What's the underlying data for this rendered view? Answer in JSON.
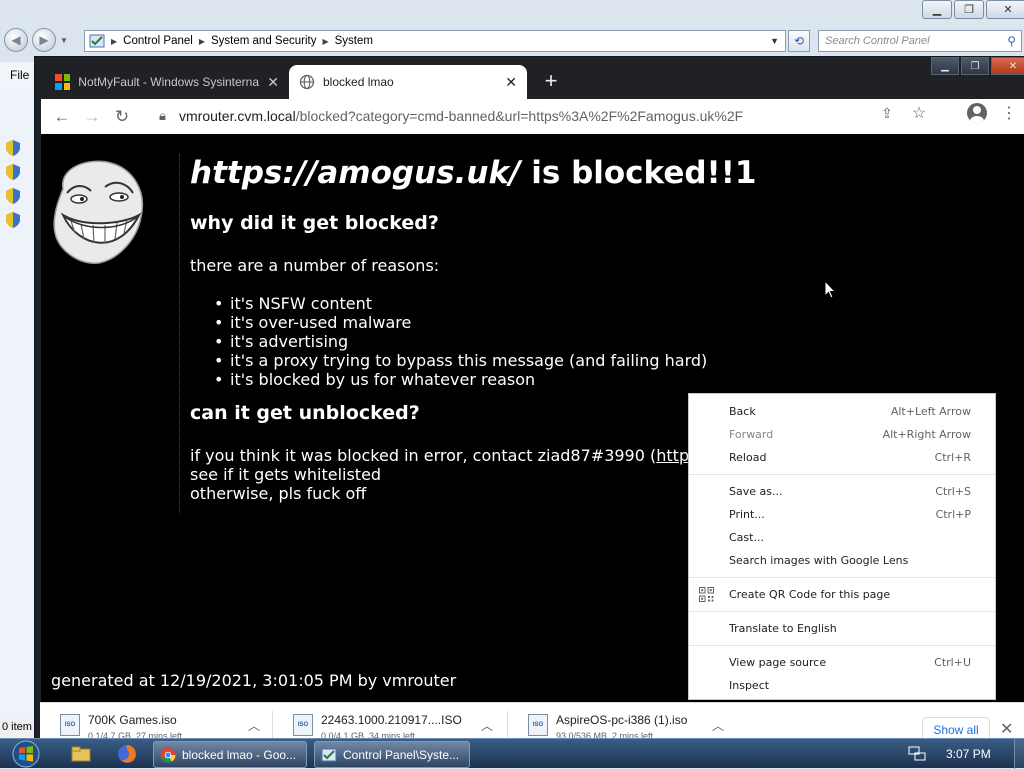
{
  "control_panel": {
    "address_crumbs": [
      "Control Panel",
      "System and Security",
      "System"
    ],
    "search_placeholder": "Search Control Panel",
    "menu_file": "File",
    "status_items": "0 item"
  },
  "browser": {
    "tabs": [
      {
        "title": "NotMyFault - Windows Sysinternals",
        "close": "✕"
      },
      {
        "title": "blocked lmao",
        "close": "✕"
      }
    ],
    "new_tab": "+",
    "url": {
      "host": "vmrouter.cvm.local",
      "path": "/blocked?category=cmd-banned&url=https%3A%2F%2Famogus.uk%2F"
    }
  },
  "page": {
    "title_url": "https://amogus.uk/",
    "title_suffix": " is blocked!!1",
    "heading_why": "why did it get blocked?",
    "reasons_intro": "there are a number of reasons:",
    "reasons": [
      "it's NSFW content",
      "it's over-used malware",
      "it's advertising",
      "it's a proxy trying to bypass this message (and failing hard)",
      "it's blocked by us for whatever reason"
    ],
    "heading_unblock": "can it get unblocked?",
    "contact_text": "if you think it was blocked in error, contact ziad87#3990 (",
    "contact_link": "http",
    "whitelist_text": "see if it gets whitelisted",
    "otherwise_text": "otherwise, pls fuck off",
    "generated": "generated at 12/19/2021, 3:01:05 PM by vmrouter"
  },
  "context_menu": {
    "items": [
      {
        "label": "Back",
        "shortcut": "Alt+Left Arrow"
      },
      {
        "label": "Forward",
        "shortcut": "Alt+Right Arrow"
      },
      {
        "label": "Reload",
        "shortcut": "Ctrl+R"
      },
      {
        "label": "Save as...",
        "shortcut": "Ctrl+S"
      },
      {
        "label": "Print...",
        "shortcut": "Ctrl+P"
      },
      {
        "label": "Cast...",
        "shortcut": ""
      },
      {
        "label": "Search images with Google Lens",
        "shortcut": ""
      },
      {
        "label": "Create QR Code for this page",
        "shortcut": ""
      },
      {
        "label": "Translate to English",
        "shortcut": ""
      },
      {
        "label": "View page source",
        "shortcut": "Ctrl+U"
      },
      {
        "label": "Inspect",
        "shortcut": ""
      }
    ]
  },
  "downloads": {
    "items": [
      {
        "name": "700K Games.iso",
        "status": "0.1/4.7 GB, 27 mins left",
        "icon_text": "ISO"
      },
      {
        "name": "22463.1000.210917....ISO",
        "status": "0.0/4.1 GB, 34 mins left",
        "icon_text": "ISO"
      },
      {
        "name": "AspireOS-pc-i386 (1).iso",
        "status": "93.0/536 MB, 2 mins left",
        "icon_text": "ISO"
      }
    ],
    "show_all": "Show all",
    "close": "✕"
  },
  "taskbar": {
    "tasks": [
      {
        "label": "blocked lmao - Goo..."
      },
      {
        "label": "Control Panel\\Syste..."
      }
    ],
    "clock": "3:07 PM"
  }
}
